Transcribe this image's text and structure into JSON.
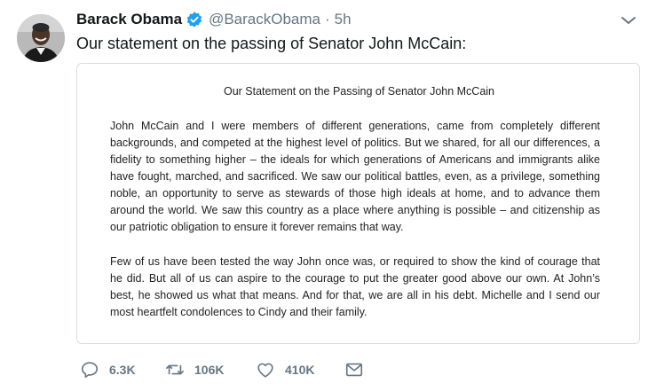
{
  "author": {
    "display_name": "Barack Obama",
    "handle": "@BarackObama",
    "separator": "·",
    "time": "5h",
    "avatar_icon": "profile-photo",
    "verified_icon": "verified-badge-icon"
  },
  "tweet": {
    "text": "Our statement on the passing of Senator John McCain:"
  },
  "statement": {
    "title": "Our Statement on the Passing of Senator John McCain",
    "paragraphs": [
      "John McCain and I were members of different generations, came from completely different backgrounds, and competed at the highest level of politics. But we shared, for all our differences, a fidelity to something higher – the ideals for which generations of Americans and immigrants alike have fought, marched, and sacrificed. We saw our political battles, even, as a privilege, something noble, an opportunity to serve as stewards of those high ideals at home, and to advance them around the world. We saw this country as a place where anything is possible – and citizenship as our patriotic obligation to ensure it forever remains that way.",
      "Few of us have been tested the way John once was, or required to show the kind of courage that he did. But all of us can aspire to the courage to put the greater good above our own. At John’s best, he showed us what that means. And for that, we are all in his debt. Michelle and I send our most heartfelt condolences to Cindy and their family."
    ]
  },
  "actions": {
    "replies": "6.3K",
    "retweets": "106K",
    "likes": "410K"
  },
  "colors": {
    "verified": "#1da1f2",
    "muted": "#657786",
    "border": "#d7dee3"
  }
}
